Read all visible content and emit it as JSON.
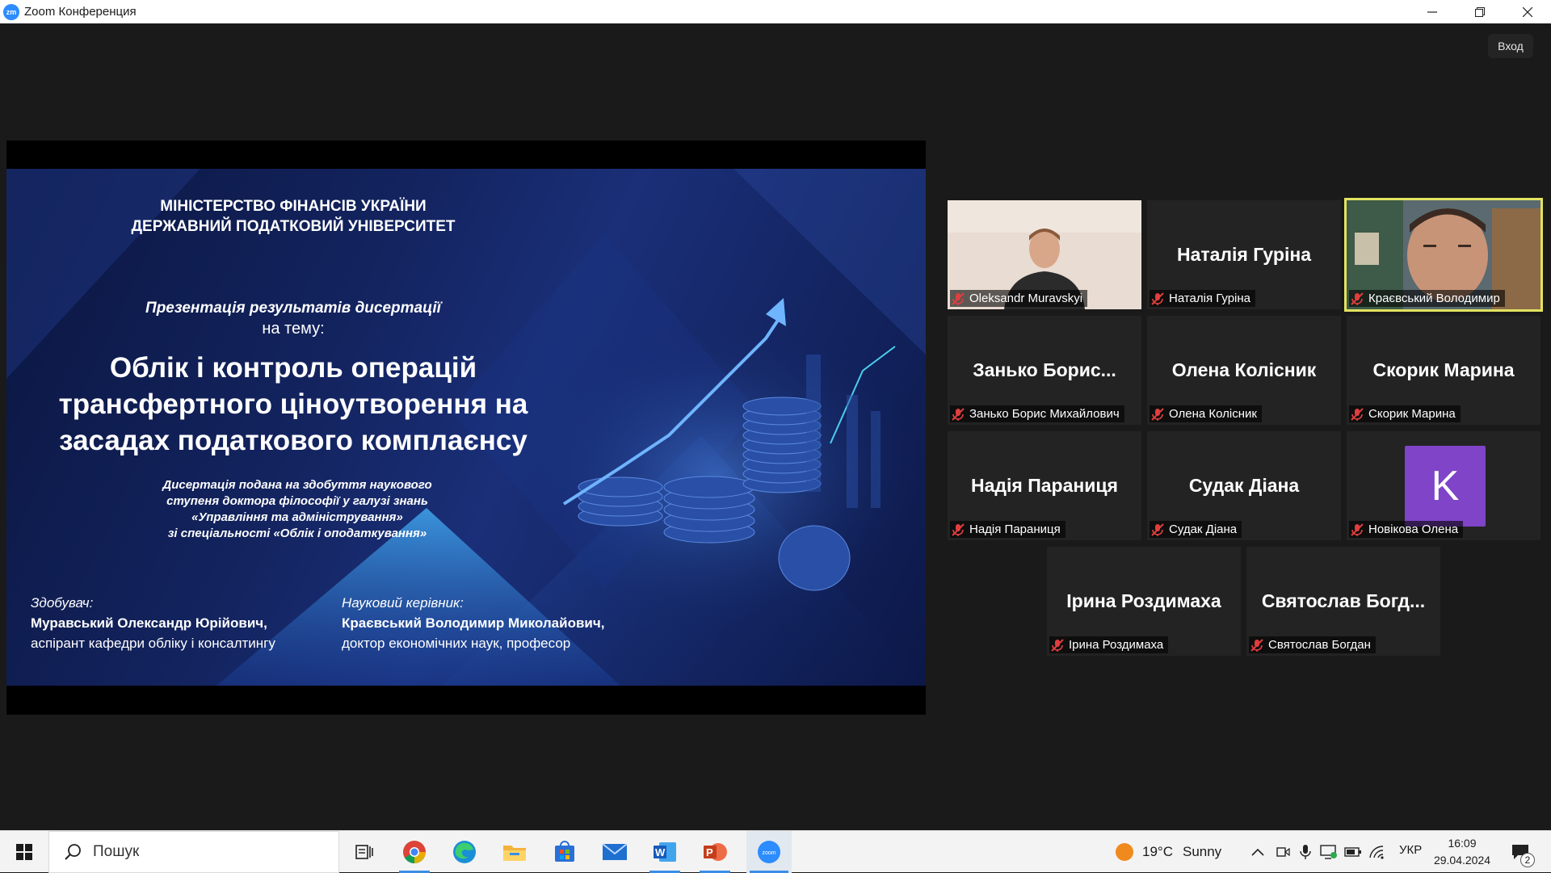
{
  "window": {
    "title": "Zoom Конференция",
    "logo_text": "zm"
  },
  "toolbar": {
    "signin_label": "Вход"
  },
  "slide": {
    "ministry_line1": "МІНІСТЕРСТВО ФІНАНСІВ УКРАЇНИ",
    "ministry_line2": "ДЕРЖАВНИЙ ПОДАТКОВИЙ УНІВЕРСИТЕТ",
    "presentation": "Презентація результатів дисертації",
    "topic_label": "на тему:",
    "title_line1": "Облік і контроль операцій",
    "title_line2": "трансфертного ціноутворення на",
    "title_line3": "засадах податкового комплаєнсу",
    "desc_line1": "Дисертація подана на здобуття наукового",
    "desc_line2": "ступеня доктора філософії у галузі знань",
    "desc_line3": "«Управління та адміністрування»",
    "desc_line4": "зі спеціальності «Облік і оподаткування»",
    "applicant_label": "Здобувач:",
    "applicant_name": "Муравський Олександр Юрійович,",
    "applicant_role": "аспірант кафедри обліку і консалтингу",
    "supervisor_label": "Науковий керівник:",
    "supervisor_name": "Краєвський Володимир Миколайович,",
    "supervisor_role": "доктор економічних наук, професор"
  },
  "participants": [
    {
      "label": "Oleksandr Muravskyi",
      "center": "",
      "video": true
    },
    {
      "label": "Наталія Гуріна",
      "center": "Наталія Гуріна",
      "video": false
    },
    {
      "label": "Краєвський Володимир",
      "center": "",
      "video": true,
      "active": true
    },
    {
      "label": "Занько Борис Михайлович",
      "center": "Занько Борис...",
      "video": false
    },
    {
      "label": "Олена Колісник",
      "center": "Олена Колісник",
      "video": false
    },
    {
      "label": "Скорик Марина",
      "center": "Скорик Марина",
      "video": false
    },
    {
      "label": "Надія Параниця",
      "center": "Надія Параниця",
      "video": false
    },
    {
      "label": "Судак Діана",
      "center": "Судак Діана",
      "video": false
    },
    {
      "label": "Новікова Олена",
      "center": "",
      "avatar_letter": "K",
      "video": false
    },
    {
      "label": "Ірина Роздимаха",
      "center": "Ірина Роздимаха",
      "video": false
    },
    {
      "label": "Святослав Богдан",
      "center": "Святослав Богд...",
      "video": false
    }
  ],
  "taskbar": {
    "search_placeholder": "Пошук",
    "weather_temp": "19°C",
    "weather_cond": "Sunny",
    "language": "УКР",
    "time": "16:09",
    "date": "29.04.2024",
    "notifications": "2"
  },
  "colors": {
    "accent": "#2d8cff",
    "active_speaker": "#e3e360",
    "mic_muted": "#e03e3e",
    "avatar": "#7f44c8"
  }
}
